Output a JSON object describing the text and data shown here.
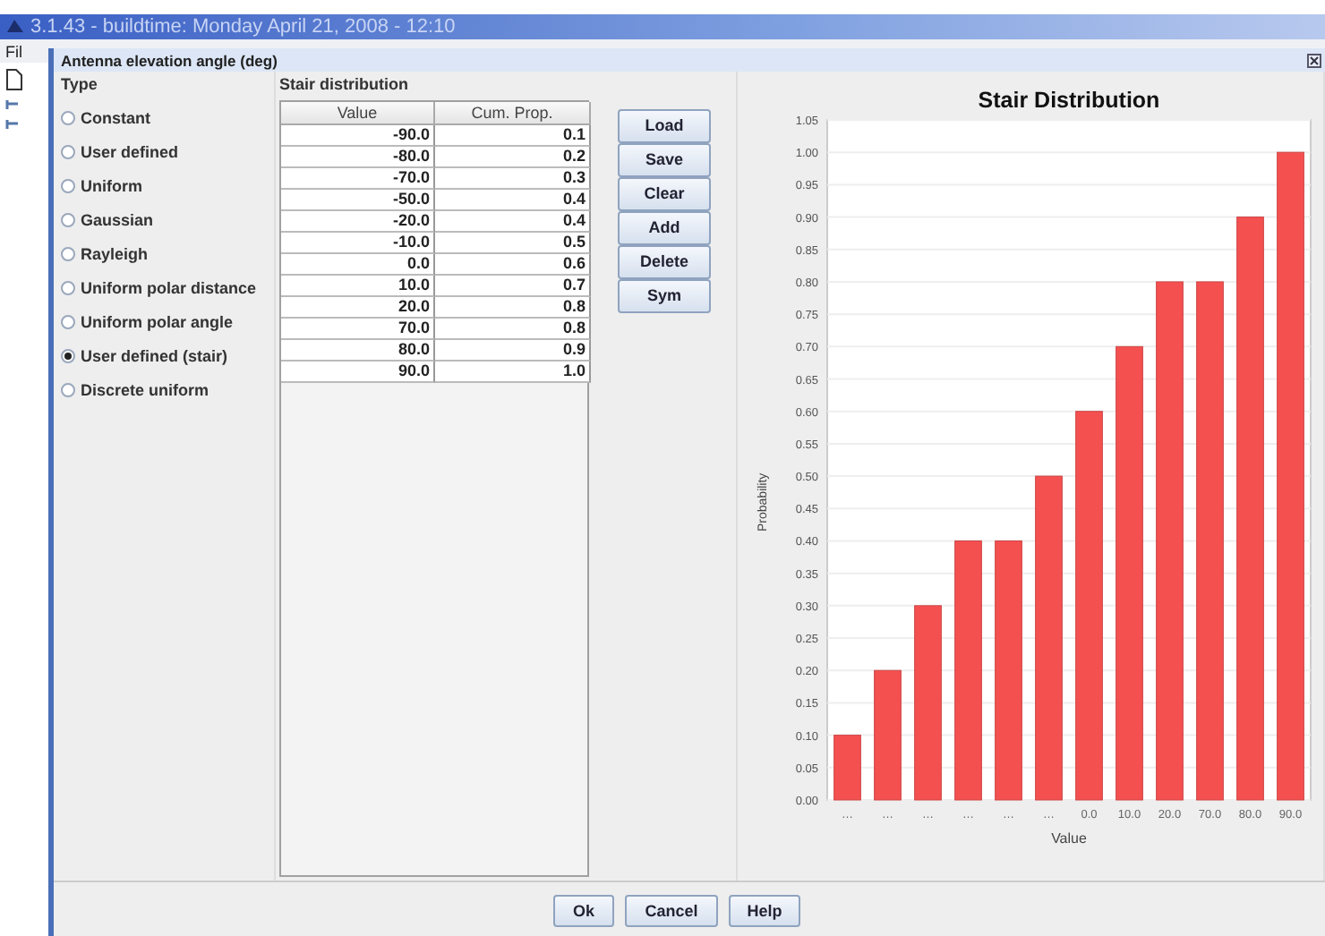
{
  "app": {
    "title": "3.1.43 - buildtime: Monday April 21, 2008 - 12:10",
    "menu": "Fil"
  },
  "dialog": {
    "title": "Antenna elevation angle (deg)",
    "type_panel": {
      "title": "Type",
      "options": [
        {
          "label": "Constant",
          "selected": false
        },
        {
          "label": "User defined",
          "selected": false
        },
        {
          "label": "Uniform",
          "selected": false
        },
        {
          "label": "Gaussian",
          "selected": false
        },
        {
          "label": "Rayleigh",
          "selected": false
        },
        {
          "label": "Uniform polar distance",
          "selected": false
        },
        {
          "label": "Uniform polar angle",
          "selected": false
        },
        {
          "label": "User defined (stair)",
          "selected": true
        },
        {
          "label": "Discrete uniform",
          "selected": false
        }
      ]
    },
    "stair_panel": {
      "title": "Stair distribution",
      "columns": [
        "Value",
        "Cum. Prop."
      ],
      "rows": [
        [
          "-90.0",
          "0.1"
        ],
        [
          "-80.0",
          "0.2"
        ],
        [
          "-70.0",
          "0.3"
        ],
        [
          "-50.0",
          "0.4"
        ],
        [
          "-20.0",
          "0.4"
        ],
        [
          "-10.0",
          "0.5"
        ],
        [
          "0.0",
          "0.6"
        ],
        [
          "10.0",
          "0.7"
        ],
        [
          "20.0",
          "0.8"
        ],
        [
          "70.0",
          "0.8"
        ],
        [
          "80.0",
          "0.9"
        ],
        [
          "90.0",
          "1.0"
        ]
      ],
      "buttons": [
        "Load",
        "Save",
        "Clear",
        "Add",
        "Delete",
        "Sym"
      ]
    },
    "chart": {
      "chart_data": {
        "type": "bar",
        "title": "Stair Distribution",
        "xlabel": "Value",
        "ylabel": "Probability",
        "categories": [
          "…",
          "…",
          "…",
          "…",
          "…",
          "…",
          "0.0",
          "10.0",
          "20.0",
          "70.0",
          "80.0",
          "90.0"
        ],
        "grid": true,
        "series": [
          {
            "color": "#f55050",
            "values": [
              0.1,
              0.2,
              0.3,
              0.4,
              0.4,
              0.5,
              0.6,
              0.7,
              0.8,
              0.8,
              0.9,
              1.0
            ]
          }
        ],
        "ylim": [
          0,
          1.05
        ],
        "yticks": [
          {
            "value": 0,
            "label": "0.00"
          },
          {
            "value": 0.05,
            "label": "0.05"
          },
          {
            "value": 0.1,
            "label": "0.10"
          },
          {
            "value": 0.15,
            "label": "0.15"
          },
          {
            "value": 0.2,
            "label": "0.20"
          },
          {
            "value": 0.25,
            "label": "0.25"
          },
          {
            "value": 0.3,
            "label": "0.30"
          },
          {
            "value": 0.35,
            "label": "0.35"
          },
          {
            "value": 0.4,
            "label": "0.40"
          },
          {
            "value": 0.45,
            "label": "0.45"
          },
          {
            "value": 0.5,
            "label": "0.50"
          },
          {
            "value": 0.55,
            "label": "0.55"
          },
          {
            "value": 0.6,
            "label": "0.60"
          },
          {
            "value": 0.65,
            "label": "0.65"
          },
          {
            "value": 0.7,
            "label": "0.70"
          },
          {
            "value": 0.75,
            "label": "0.75"
          },
          {
            "value": 0.8,
            "label": "0.80"
          },
          {
            "value": 0.85,
            "label": "0.85"
          },
          {
            "value": 0.9,
            "label": "0.90"
          },
          {
            "value": 0.95,
            "label": "0.95"
          },
          {
            "value": 1.0,
            "label": "1.00"
          },
          {
            "value": 1.05,
            "label": "1.05"
          }
        ]
      }
    },
    "buttons": [
      "Ok",
      "Cancel",
      "Help"
    ]
  }
}
